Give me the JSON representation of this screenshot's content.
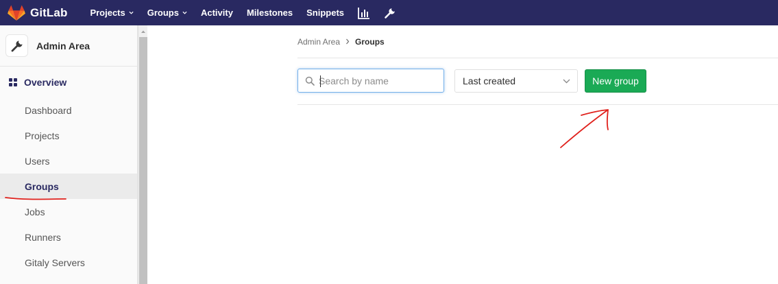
{
  "app": {
    "name": "GitLab"
  },
  "topnav": {
    "links": [
      "Projects",
      "Groups",
      "Activity",
      "Milestones",
      "Snippets"
    ],
    "icons": [
      "chart-icon",
      "wrench-icon"
    ]
  },
  "sidebar": {
    "title": "Admin Area",
    "section": "Overview",
    "items": [
      "Dashboard",
      "Projects",
      "Users",
      "Groups",
      "Jobs",
      "Runners",
      "Gitaly Servers"
    ],
    "active": "Groups"
  },
  "breadcrumb": {
    "parent": "Admin Area",
    "current": "Groups"
  },
  "toolbar": {
    "search_placeholder": "Search by name",
    "sort_value": "Last created",
    "new_group_label": "New group"
  },
  "colors": {
    "navbar": "#292961",
    "primary_button": "#1aaa55",
    "annotation": "#e0201b"
  }
}
